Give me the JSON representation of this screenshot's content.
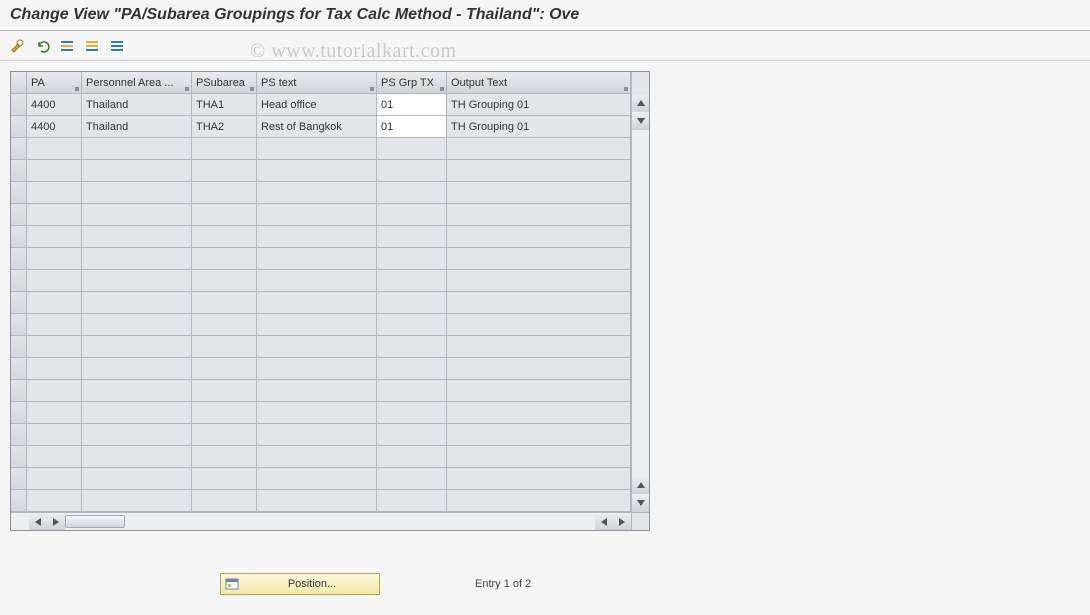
{
  "title": "Change View \"PA/Subarea Groupings for Tax Calc Method - Thailand\": Ove",
  "watermark": "© www.tutorialkart.com",
  "toolbar": {
    "icons": [
      "wrench-icon",
      "undo-icon",
      "select-all-icon",
      "select-block-icon",
      "deselect-icon"
    ]
  },
  "table": {
    "columns": {
      "pa": "PA",
      "pa_text": "Personnel Area ...",
      "psubarea": "PSubarea",
      "ps_text": "PS text",
      "ps_grp": "PS Grp TX",
      "output": "Output Text"
    },
    "rows": [
      {
        "pa": "4400",
        "pa_text": "Thailand",
        "psubarea": "THA1",
        "ps_text": "Head office",
        "ps_grp": "01",
        "output": "TH Grouping 01"
      },
      {
        "pa": "4400",
        "pa_text": "Thailand",
        "psubarea": "THA2",
        "ps_text": "Rest of Bangkok",
        "ps_grp": "01",
        "output": "TH Grouping 01"
      }
    ]
  },
  "footer": {
    "position_label": "Position...",
    "entry_text": "Entry 1 of 2"
  }
}
